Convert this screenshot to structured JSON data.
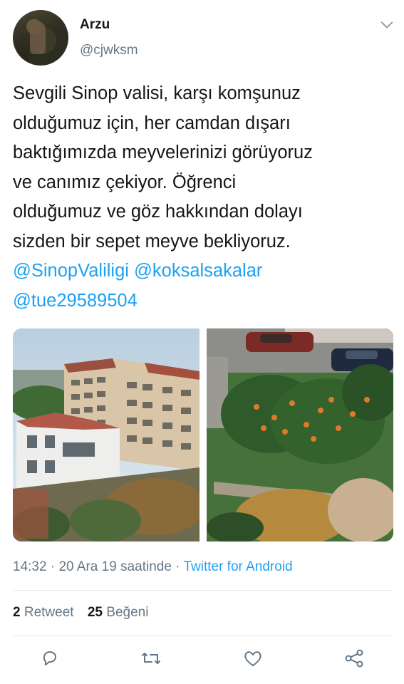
{
  "user": {
    "name": "Arzu",
    "handle": "@cjwksm"
  },
  "tweet": {
    "text": "Sevgili Sinop valisi, karşı komşunuz\nolduğumuz için, her camdan dışarı\nbaktığımızda meyvelerinizi görüyoruz\nve canımız çekiyor. Öğrenci\nolduğumuz ve göz hakkından dolayı\nsizden bir sepet meyve bekliyoruz.",
    "mentions": [
      "@SinopValiligi",
      "@koksalsakalar",
      "@tue29589504"
    ]
  },
  "meta": {
    "time": "14:32",
    "separator1": " · ",
    "date": "20 Ara 19 saatinde",
    "separator2": " · ",
    "source": "Twitter for Android"
  },
  "stats": {
    "retweets_count": "2",
    "retweets_label": "Retweet",
    "likes_count": "25",
    "likes_label": "Beğeni"
  },
  "icons": {
    "menu": "chevron-down-icon",
    "reply": "reply-icon",
    "retweet": "retweet-icon",
    "like": "heart-icon",
    "share": "share-icon"
  },
  "colors": {
    "accent": "#1da1f2",
    "secondary_text": "#657786",
    "primary_text": "#14171a",
    "icon": "#657786",
    "divider": "#e1e8ed"
  }
}
